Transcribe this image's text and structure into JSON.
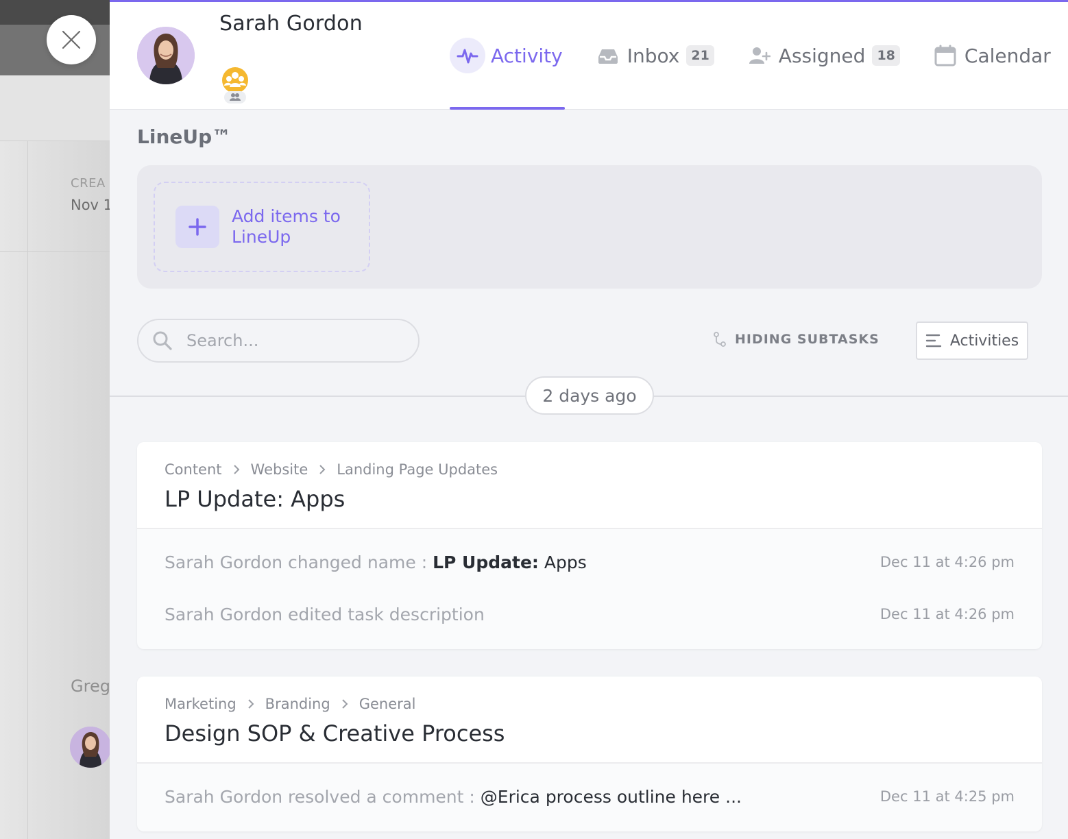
{
  "background": {
    "created_label": "CREA",
    "created_date": "Nov 1",
    "user_name": "Greg"
  },
  "profile": {
    "name": "Sarah Gordon"
  },
  "tabs": [
    {
      "label": "Activity",
      "icon": "activity-pulse-icon",
      "active": true
    },
    {
      "label": "Inbox",
      "icon": "inbox-tray-icon",
      "badge": "21"
    },
    {
      "label": "Assigned",
      "icon": "user-plus-icon",
      "badge": "18"
    },
    {
      "label": "Calendar",
      "icon": "calendar-icon"
    }
  ],
  "lineup": {
    "title": "LineUp™",
    "add_label": "Add items to LineUp"
  },
  "toolbar": {
    "search_placeholder": "Search...",
    "hiding_subtasks": "HIDING SUBTASKS",
    "activities_label": "Activities"
  },
  "date_divider": "2 days ago",
  "cards": [
    {
      "breadcrumb": [
        "Content",
        "Website",
        "Landing Page Updates"
      ],
      "title": "LP Update: Apps",
      "activities": [
        {
          "actor_text": "Sarah Gordon changed name : ",
          "value_bold": "LP Update:",
          "value_rest": " Apps",
          "time": "Dec 11 at 4:26 pm"
        },
        {
          "actor_text": "Sarah Gordon edited task description",
          "time": "Dec 11 at 4:26 pm"
        }
      ]
    },
    {
      "breadcrumb": [
        "Marketing",
        "Branding",
        "General"
      ],
      "title": "Design SOP & Creative Process",
      "activities": [
        {
          "actor_text": "Sarah Gordon resolved a comment : ",
          "value_dark": "@Erica process outline here ...",
          "time": "Dec 11 at 4:25 pm"
        }
      ]
    }
  ],
  "colors": {
    "accent": "#7b68ee",
    "team_icon": "#f5b830"
  }
}
